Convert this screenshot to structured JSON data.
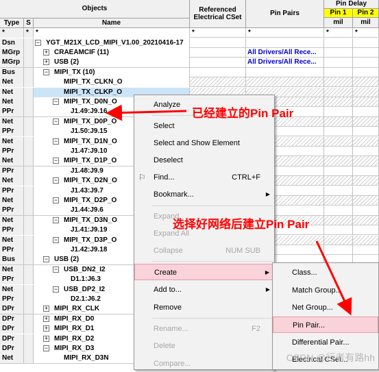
{
  "header": {
    "objects": "Objects",
    "type": "Type",
    "s": "S",
    "name": "Name",
    "referenced": "Referenced Electrical CSet",
    "pin_pairs": "Pin Pairs",
    "pin_delay": "Pin Delay",
    "pin1": "Pin 1",
    "pin2": "Pin 2",
    "mil1": "mil",
    "mil2": "mil"
  },
  "filter_row": {
    "type": "*",
    "s": "*",
    "name": "*",
    "ref": "*",
    "pp": "*",
    "p1": "*",
    "p2": "*"
  },
  "rows": [
    {
      "type": "Dsn",
      "name": "YGT_M21X_LCD_MIPI_V1.00_20210416-17",
      "expander": "−",
      "pp": ""
    },
    {
      "type": "MGrp",
      "name": "CRAEAMCIF (11)",
      "expander": "+",
      "pp": "All Drivers/All Rece..."
    },
    {
      "type": "MGrp",
      "name": "USB (2)",
      "expander": "+",
      "pp": "All Drivers/All Rece..."
    },
    {
      "type": "Bus",
      "name": "MIPI_TX (10)",
      "expander": "−",
      "pp": ""
    },
    {
      "type": "Net",
      "name": "MIPI_TX_CLKN_O",
      "expander": "",
      "pp": ""
    },
    {
      "type": "Net",
      "name": "MIPI_TX_CLKP_O",
      "expander": "",
      "pp": ""
    },
    {
      "type": "Net",
      "name": "MIPI_TX_D0N_O",
      "expander": "−",
      "pp": ""
    },
    {
      "type": "PPr",
      "name": "J1.49:J9.16",
      "expander": "",
      "pp": ""
    },
    {
      "type": "Net",
      "name": "MIPI_TX_D0P_O",
      "expander": "−",
      "pp": ""
    },
    {
      "type": "PPr",
      "name": "J1.50:J9.15",
      "expander": "",
      "pp": ""
    },
    {
      "type": "Net",
      "name": "MIPI_TX_D1N_O",
      "expander": "−",
      "pp": ""
    },
    {
      "type": "PPr",
      "name": "J1.47:J9.10",
      "expander": "",
      "pp": ""
    },
    {
      "type": "Net",
      "name": "MIPI_TX_D1P_O",
      "expander": "−",
      "pp": ""
    },
    {
      "type": "PPr",
      "name": "J1.48:J9.9",
      "expander": "",
      "pp": ""
    },
    {
      "type": "Net",
      "name": "MIPI_TX_D2N_O",
      "expander": "−",
      "pp": ""
    },
    {
      "type": "PPr",
      "name": "J1.43:J9.7",
      "expander": "",
      "pp": ""
    },
    {
      "type": "Net",
      "name": "MIPI_TX_D2P_O",
      "expander": "−",
      "pp": ""
    },
    {
      "type": "PPr",
      "name": "J1.44:J9.6",
      "expander": "",
      "pp": ""
    },
    {
      "type": "Net",
      "name": "MIPI_TX_D3N_O",
      "expander": "−",
      "pp": ""
    },
    {
      "type": "PPr",
      "name": "J1.41:J9.19",
      "expander": "",
      "pp": ""
    },
    {
      "type": "Net",
      "name": "MIPI_TX_D3P_O",
      "expander": "−",
      "pp": ""
    },
    {
      "type": "PPr",
      "name": "J1.42:J9.18",
      "expander": "",
      "pp": ""
    },
    {
      "type": "Bus",
      "name": "USB (2)",
      "expander": "−",
      "pp": ""
    },
    {
      "type": "Net",
      "name": "USB_DN2_I2",
      "expander": "−",
      "pp": ""
    },
    {
      "type": "PPr",
      "name": "D1.1:J6.3",
      "expander": "",
      "pp": ""
    },
    {
      "type": "Net",
      "name": "USB_DP2_I2",
      "expander": "−",
      "pp": ""
    },
    {
      "type": "PPr",
      "name": "D2.1:J6.2",
      "expander": "",
      "pp": ""
    },
    {
      "type": "DPr",
      "name": "MIPI_RX_CLK",
      "expander": "+",
      "pp": ""
    },
    {
      "type": "DPr",
      "name": "MIPI_RX_D0",
      "expander": "+",
      "pp": ""
    },
    {
      "type": "DPr",
      "name": "MIPI_RX_D1",
      "expander": "+",
      "pp": ""
    },
    {
      "type": "DPr",
      "name": "MIPI_RX_D2",
      "expander": "+",
      "pp": ""
    },
    {
      "type": "DPr",
      "name": "MIPI_RX_D3",
      "expander": "−",
      "pp": ""
    },
    {
      "type": "Net",
      "name": "MIPI_RX_D3N",
      "expander": "",
      "pp": ""
    }
  ],
  "context_menu": {
    "items": [
      {
        "label": "Analyze",
        "shortcut": "",
        "disabled": false,
        "submenu": false
      },
      {
        "label": "Select",
        "shortcut": "",
        "disabled": false,
        "submenu": false
      },
      {
        "label": "Select and Show Element",
        "shortcut": "",
        "disabled": false,
        "submenu": false
      },
      {
        "label": "Deselect",
        "shortcut": "",
        "disabled": false,
        "submenu": false
      },
      {
        "label": "Find...",
        "shortcut": "CTRL+F",
        "disabled": false,
        "submenu": false
      },
      {
        "label": "Bookmark...",
        "shortcut": "",
        "disabled": false,
        "submenu": true
      },
      {
        "label": "Expand",
        "shortcut": "",
        "disabled": true,
        "submenu": false
      },
      {
        "label": "Expand All",
        "shortcut": "",
        "disabled": true,
        "submenu": false
      },
      {
        "label": "Collapse",
        "shortcut": "NUM SUB",
        "disabled": true,
        "submenu": false
      },
      {
        "label": "Create",
        "shortcut": "",
        "disabled": false,
        "submenu": true
      },
      {
        "label": "Add to...",
        "shortcut": "",
        "disabled": false,
        "submenu": true
      },
      {
        "label": "Remove",
        "shortcut": "",
        "disabled": false,
        "submenu": false
      },
      {
        "label": "Rename...",
        "shortcut": "F2",
        "disabled": true,
        "submenu": false
      },
      {
        "label": "Delete",
        "shortcut": "",
        "disabled": true,
        "submenu": false
      },
      {
        "label": "Compare...",
        "shortcut": "",
        "disabled": true,
        "submenu": false
      }
    ]
  },
  "create_submenu": {
    "items": [
      {
        "label": "Class..."
      },
      {
        "label": "Match Group..."
      },
      {
        "label": "Net Group..."
      },
      {
        "label": "Pin Pair..."
      },
      {
        "label": "Differential Pair..."
      },
      {
        "label": "Electrical CSet..."
      }
    ]
  },
  "annotations": {
    "top": "已经建立的Pin Pair",
    "bottom": "选择好网络后建立Pin Pair",
    "color": "#ff0000"
  },
  "watermark": "CSDN @行者有路hh"
}
